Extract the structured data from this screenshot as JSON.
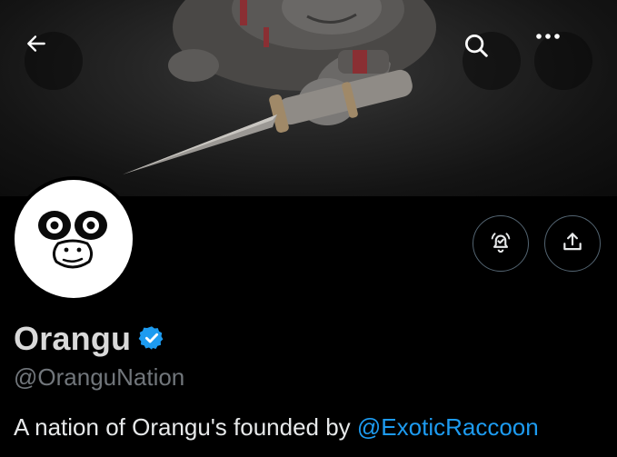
{
  "profile": {
    "display_name": "Orangu",
    "handle": "@OranguNation",
    "bio_text": "A nation of Orangu's founded by ",
    "bio_mention": "@ExoticRaccoon",
    "verified": true
  },
  "icons": {
    "back": "arrow-left-icon",
    "search": "search-icon",
    "more": "more-horizontal-icon",
    "notify": "bell-check-icon",
    "share": "share-upload-icon",
    "verified": "verified-badge-icon"
  },
  "colors": {
    "background": "#000000",
    "link": "#1d9bf0",
    "verified_badge": "#1d9bf0",
    "muted_text": "#71767b",
    "primary_text": "#e7e9ea"
  }
}
